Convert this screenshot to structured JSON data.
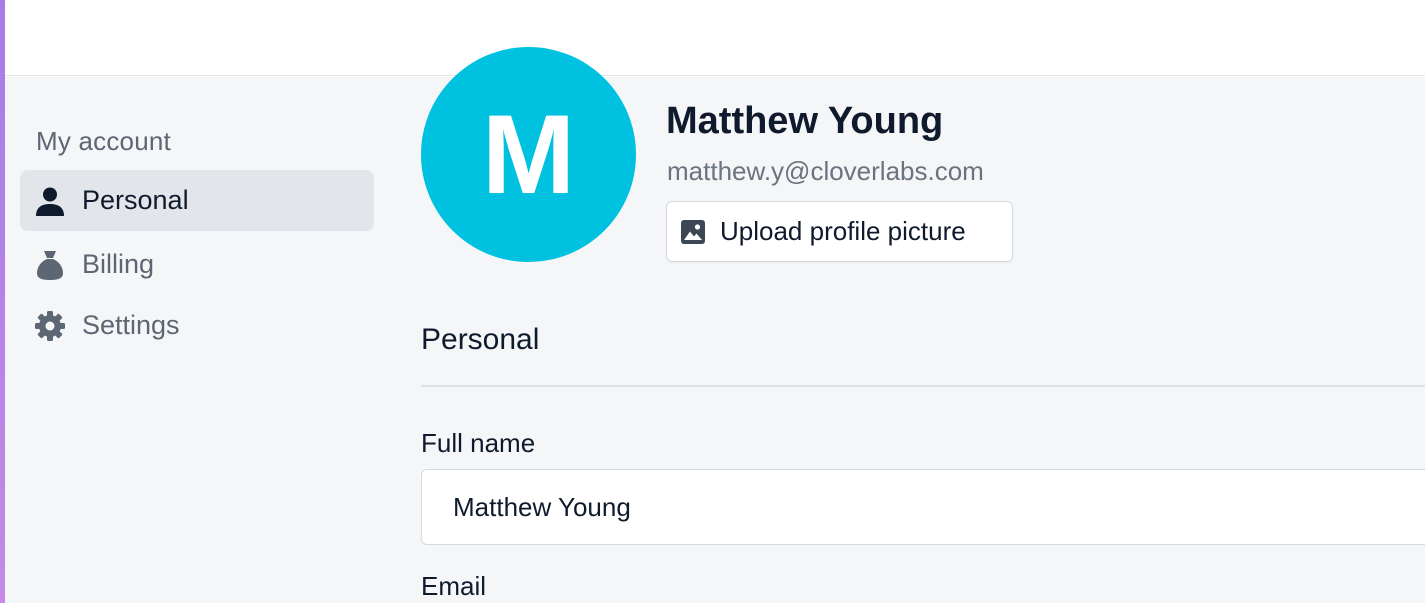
{
  "sidebar": {
    "heading": "My account",
    "items": [
      {
        "label": "Personal",
        "icon": "person-icon",
        "active": true
      },
      {
        "label": "Billing",
        "icon": "money-bag-icon",
        "active": false
      },
      {
        "label": "Settings",
        "icon": "gear-icon",
        "active": false
      }
    ]
  },
  "profile": {
    "avatar_initial": "M",
    "avatar_color": "#00c2e0",
    "name": "Matthew Young",
    "email": "matthew.y@cloverlabs.com",
    "upload_label": "Upload profile picture",
    "upload_icon": "image-icon"
  },
  "section": {
    "title": "Personal",
    "fields": {
      "full_name_label": "Full name",
      "full_name_value": "Matthew Young",
      "email_label": "Email"
    }
  }
}
